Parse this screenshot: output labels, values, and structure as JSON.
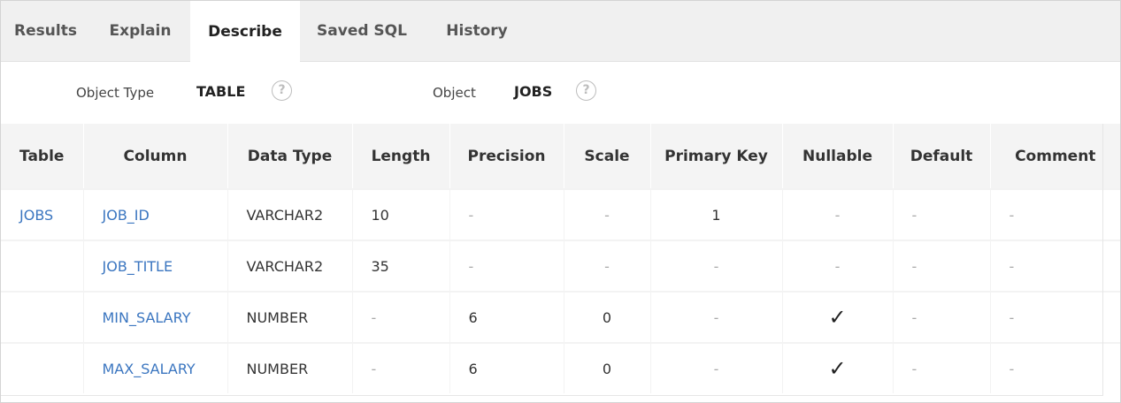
{
  "tabs": [
    {
      "label": "Results"
    },
    {
      "label": "Explain"
    },
    {
      "label": "Describe"
    },
    {
      "label": "Saved SQL"
    },
    {
      "label": "History"
    }
  ],
  "active_tab": "Describe",
  "info": {
    "object_type_label": "Object Type",
    "object_type_value": "TABLE",
    "object_label": "Object",
    "object_value": "JOBS",
    "help_glyph": "?"
  },
  "table": {
    "headers": [
      "Table",
      "Column",
      "Data Type",
      "Length",
      "Precision",
      "Scale",
      "Primary Key",
      "Nullable",
      "Default",
      "Comment"
    ],
    "rows": [
      [
        "JOBS",
        "JOB_ID",
        "VARCHAR2",
        "10",
        "-",
        "-",
        "1",
        "-",
        "-",
        "-"
      ],
      [
        "",
        "JOB_TITLE",
        "VARCHAR2",
        "35",
        "-",
        "-",
        "-",
        "-",
        "-",
        "-"
      ],
      [
        "",
        "MIN_SALARY",
        "NUMBER",
        "-",
        "6",
        "0",
        "-",
        "✓",
        "-",
        "-"
      ],
      [
        "",
        "MAX_SALARY",
        "NUMBER",
        "-",
        "6",
        "0",
        "-",
        "✓",
        "-",
        "-"
      ]
    ]
  },
  "colors": {
    "link": "#3b76c0",
    "tab_bar_bg": "#f0f0f0",
    "header_bg": "#f4f4f4"
  }
}
